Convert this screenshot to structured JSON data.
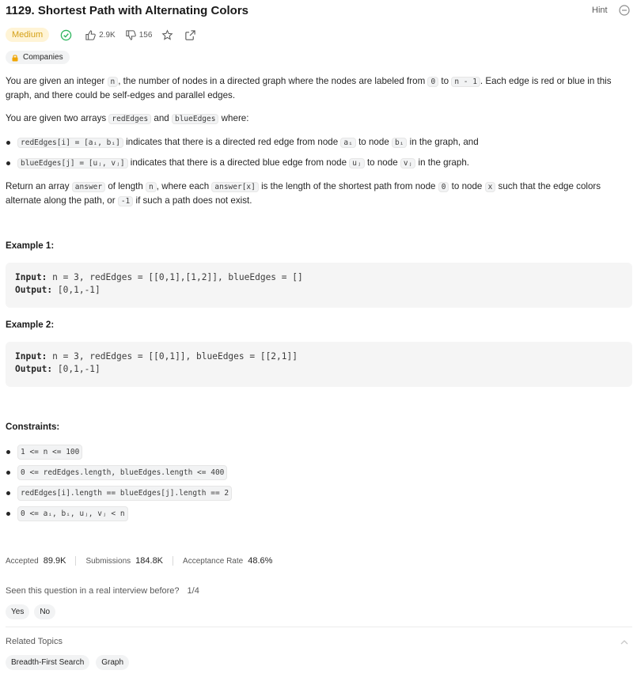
{
  "problem": {
    "title": "1129. Shortest Path with Alternating Colors",
    "hint_label": "Hint",
    "difficulty": "Medium",
    "likes": "2.9K",
    "dislikes": "156",
    "companies_label": "Companies",
    "colors": {
      "difficulty_text": "#d4a017",
      "difficulty_bg": "#fff4d6",
      "solved_check": "#2db55d"
    }
  },
  "description": {
    "p1": {
      "a": "You are given an integer ",
      "n": "n",
      "b": ", the number of nodes in a directed graph where the nodes are labeled from ",
      "zero": "0",
      "c": " to ",
      "nm1": "n - 1",
      "d": ". Each edge is red or blue in this graph, and there could be self-edges and parallel edges."
    },
    "p2": {
      "a": "You are given two arrays ",
      "red": "redEdges",
      "b": " and ",
      "blue": "blueEdges",
      "c": " where:"
    },
    "b1": {
      "code": "redEdges[i] = [aᵢ, bᵢ]",
      "a": " indicates that there is a directed red edge from node ",
      "ai": "aᵢ",
      "b": " to node ",
      "bi": "bᵢ",
      "c": " in the graph, and"
    },
    "b2": {
      "code": "blueEdges[j] = [uⱼ, vⱼ]",
      "a": " indicates that there is a directed blue edge from node ",
      "uj": "uⱼ",
      "b": " to node ",
      "vj": "vⱼ",
      "c": " in the graph."
    },
    "p3": {
      "a": "Return an array ",
      "answer": "answer",
      "b": " of length ",
      "n": "n",
      "c": ", where each ",
      "answer_x": "answer[x]",
      "d": " is the length of the shortest path from node ",
      "zero": "0",
      "e": " to node ",
      "x": "x",
      "f": " such that the edge colors alternate along the path, or ",
      "neg1": "-1",
      "g": " if such a path does not exist."
    }
  },
  "examples": [
    {
      "heading": "Example 1:",
      "input_label": "Input:",
      "input": " n = 3, redEdges = [[0,1],[1,2]], blueEdges = []",
      "output_label": "Output:",
      "output": " [0,1,-1]"
    },
    {
      "heading": "Example 2:",
      "input_label": "Input:",
      "input": " n = 3, redEdges = [[0,1]], blueEdges = [[2,1]]",
      "output_label": "Output:",
      "output": " [0,1,-1]"
    }
  ],
  "constraints": {
    "heading": "Constraints:",
    "items": [
      "1 <= n <= 100",
      "0 <= redEdges.length, blueEdges.length <= 400",
      "redEdges[i].length == blueEdges[j].length == 2",
      "0 <= aᵢ, bᵢ, uⱼ, vⱼ < n"
    ]
  },
  "stats": {
    "accepted_label": "Accepted",
    "accepted": "89.9K",
    "submissions_label": "Submissions",
    "submissions": "184.8K",
    "rate_label": "Acceptance Rate",
    "rate": "48.6%"
  },
  "interview": {
    "question": "Seen this question in a real interview before?",
    "fraction": "1/4",
    "yes": "Yes",
    "no": "No"
  },
  "related": {
    "label": "Related Topics",
    "topics": [
      "Breadth-First Search",
      "Graph"
    ]
  }
}
